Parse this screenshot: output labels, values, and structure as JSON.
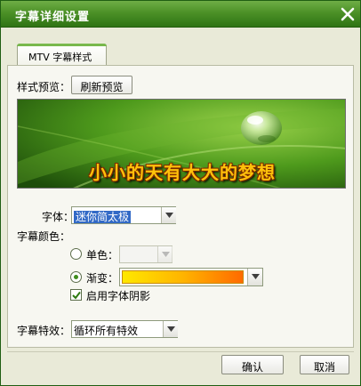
{
  "window": {
    "title": "字幕详细设置"
  },
  "tab": {
    "label": "MTV 字幕样式"
  },
  "preview": {
    "label": "样式预览：",
    "refresh_button": "刷新预览",
    "sample_text": "小小的天有大大的梦想"
  },
  "font": {
    "label": "字体：",
    "value": "迷你简太极"
  },
  "color": {
    "section_label": "字幕颜色：",
    "single_label": "单色：",
    "gradient_label": "渐变：",
    "gradient_stops": [
      "#ffe800",
      "#ffb400",
      "#ff6a00"
    ],
    "single_selected": false,
    "gradient_selected": true
  },
  "shadow": {
    "label": "启用字体阴影",
    "checked": true
  },
  "effect": {
    "label": "字幕特效：",
    "value": "循环所有特效"
  },
  "buttons": {
    "ok": "确认",
    "cancel": "取消"
  },
  "colors": {
    "title_bar": "#4c9127",
    "dialog_bg": "#e9ead8",
    "accent": "#78b84c"
  }
}
